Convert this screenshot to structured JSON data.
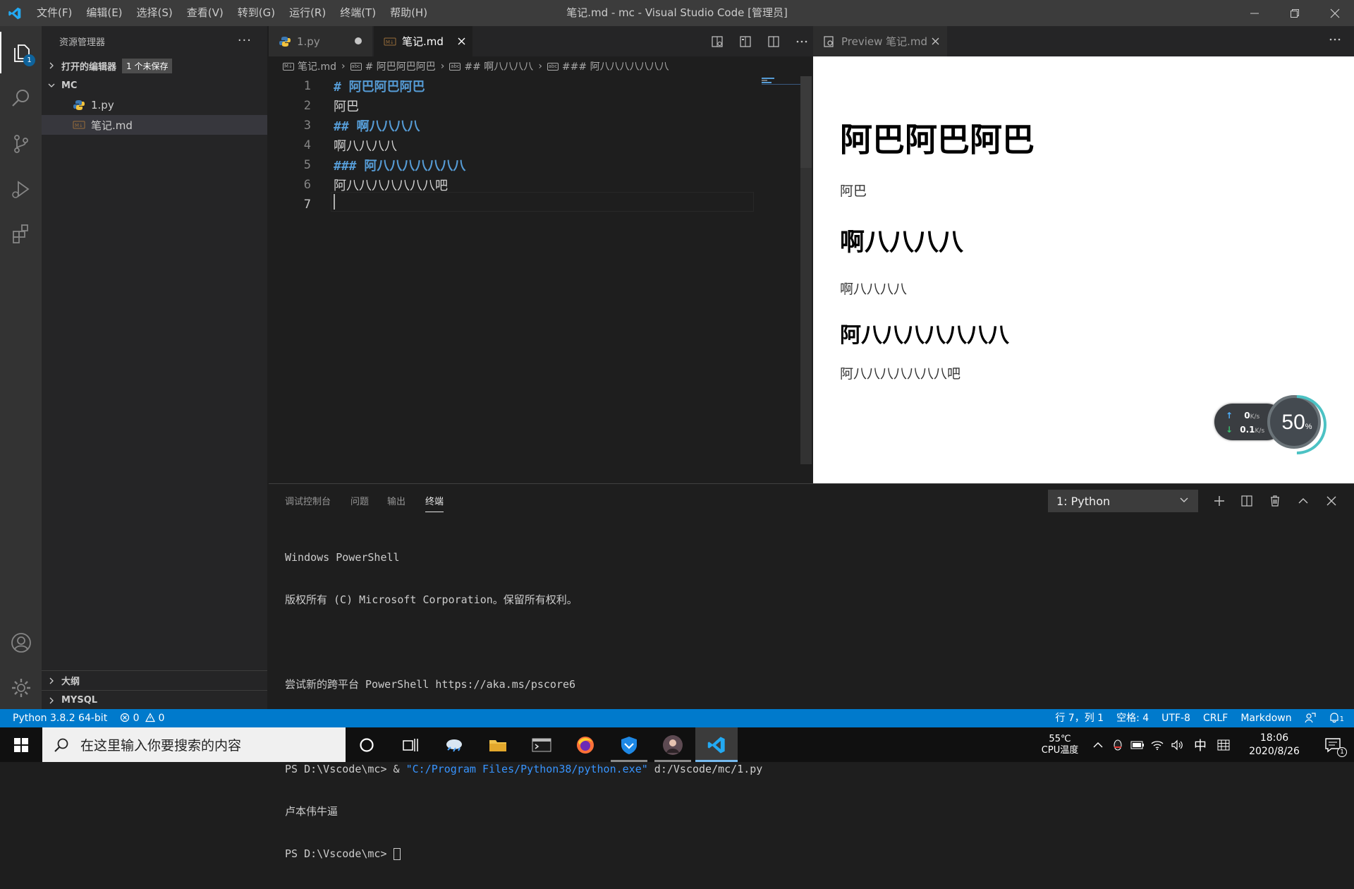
{
  "titlebar": {
    "menus": [
      "文件(F)",
      "编辑(E)",
      "选择(S)",
      "查看(V)",
      "转到(G)",
      "运行(R)",
      "终端(T)",
      "帮助(H)"
    ],
    "window_title": "笔记.md - mc - Visual Studio Code [管理员]"
  },
  "activity": {
    "explorer_badge": "1"
  },
  "sidebar": {
    "title": "资源管理器",
    "open_editors": "打开的编辑器",
    "unsaved": "1 个未保存",
    "folder": "MC",
    "files": [
      "1.py",
      "笔记.md"
    ],
    "outline": "大纲",
    "mysql": "MYSQL"
  },
  "editor": {
    "tabs": [
      {
        "label": "1.py",
        "state": "modified"
      },
      {
        "label": "笔记.md",
        "state": "active"
      }
    ],
    "breadcrumb": [
      "笔记.md",
      "# 阿巴阿巴阿巴",
      "## 啊八八八八",
      "### 阿八八八八八八八"
    ],
    "lines": [
      {
        "n": "1",
        "text": "# 阿巴阿巴阿巴",
        "kind": "heading"
      },
      {
        "n": "2",
        "text": "阿巴",
        "kind": "text"
      },
      {
        "n": "3",
        "text": "## 啊八八八八",
        "kind": "heading"
      },
      {
        "n": "4",
        "text": "啊八八八八",
        "kind": "text"
      },
      {
        "n": "5",
        "text": "### 阿八八八八八八八",
        "kind": "heading"
      },
      {
        "n": "6",
        "text": "阿八八八八八八八吧",
        "kind": "text"
      },
      {
        "n": "7",
        "text": "",
        "kind": "text"
      }
    ]
  },
  "preview": {
    "tab_label": "Preview 笔记.md",
    "h1": "阿巴阿巴阿巴",
    "p1": "阿巴",
    "h2": "啊八八八八",
    "p2": "啊八八八八",
    "h3": "阿八八八八八八八",
    "p3": "阿八八八八八八八吧"
  },
  "netwidget": {
    "up": "0",
    "down": "0.1",
    "unit": "K/s",
    "cpu_percent": "50",
    "cpu_unit": "%"
  },
  "panel": {
    "tabs": [
      "调试控制台",
      "问题",
      "输出",
      "终端"
    ],
    "active_tab": "终端",
    "terminal_select": "1: Python",
    "terminal": {
      "l1": "Windows PowerShell",
      "l2": "版权所有 (C) Microsoft Corporation。保留所有权利。",
      "l3": "尝试新的跨平台 PowerShell https://aka.ms/pscore6",
      "l4_prompt": "PS D:\\Vscode\\mc> & ",
      "l4_str": "\"C:/Program Files/Python38/python.exe\"",
      "l4_arg": " d:/Vscode/mc/1.py",
      "l5": "卢本伟牛逼",
      "l6_prompt": "PS D:\\Vscode\\mc> "
    }
  },
  "statusbar": {
    "interpreter": "Python 3.8.2 64-bit",
    "errors": "0",
    "warnings": "0",
    "position": "行 7，列 1",
    "spaces": "空格: 4",
    "encoding": "UTF-8",
    "eol": "CRLF",
    "language": "Markdown",
    "notif_count": "1"
  },
  "taskbar": {
    "search_placeholder": "在这里输入你要搜索的内容",
    "temp": "55℃",
    "temp_label": "CPU温度",
    "ime": "中",
    "time": "18:06",
    "date": "2020/8/26",
    "notif": "1"
  },
  "colors": {
    "accent": "#007acc",
    "heading": "#569cd6",
    "terminal_string": "#3794ff"
  }
}
